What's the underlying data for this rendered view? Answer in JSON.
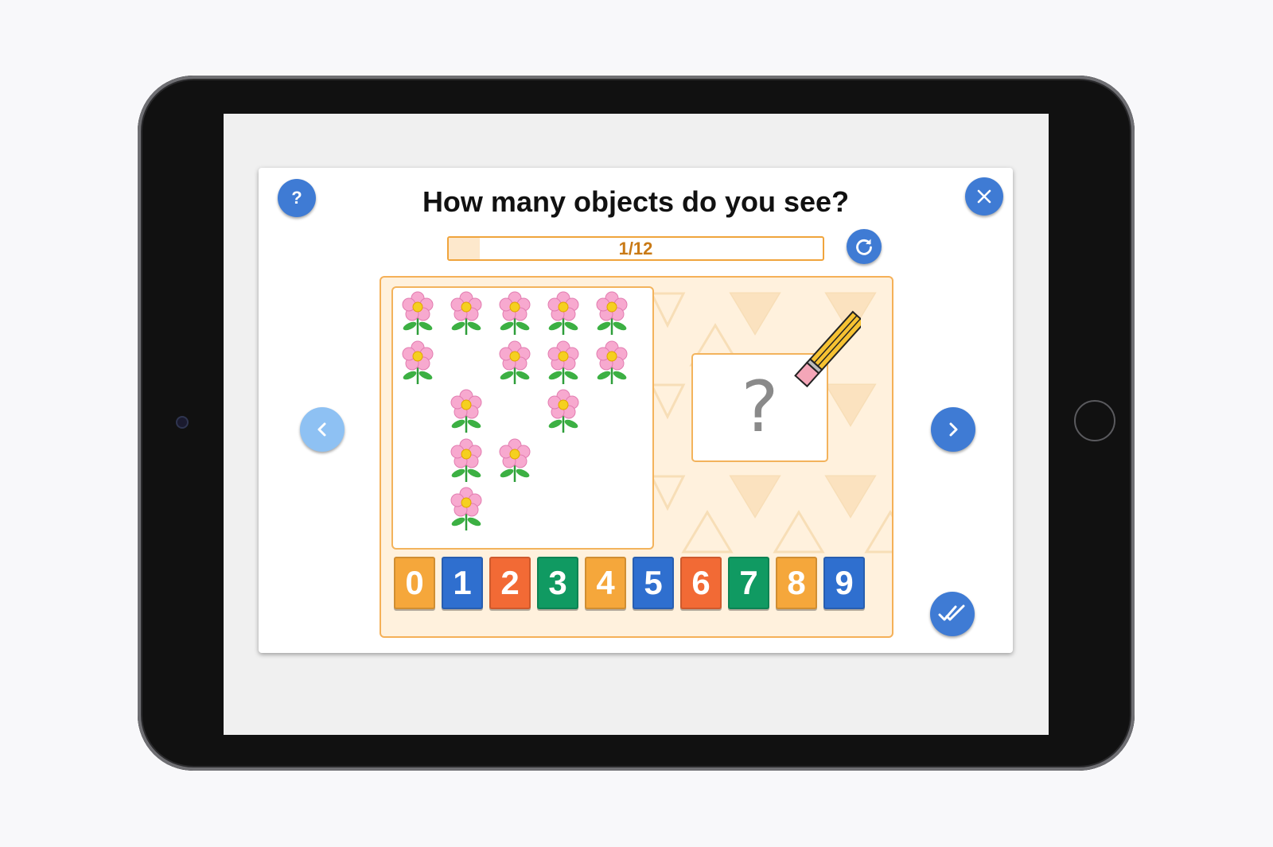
{
  "game": {
    "title": "How many objects do you see?",
    "progress_text": "1/12",
    "progress_fraction": 0.0833,
    "answer_placeholder": "?",
    "help_label": "?",
    "icons": {
      "help": "question-icon",
      "close": "close-icon",
      "refresh": "refresh-icon",
      "prev": "chevron-left-icon",
      "next": "chevron-right-icon",
      "check": "double-check-icon",
      "pencil": "pencil-icon",
      "flower": "flower-icon"
    },
    "flower_count": 14,
    "number_tiles": [
      {
        "label": "0",
        "color": "#f5a73b"
      },
      {
        "label": "1",
        "color": "#2f6fcf"
      },
      {
        "label": "2",
        "color": "#f26a35"
      },
      {
        "label": "3",
        "color": "#109a62"
      },
      {
        "label": "4",
        "color": "#f5a73b"
      },
      {
        "label": "5",
        "color": "#2f6fcf"
      },
      {
        "label": "6",
        "color": "#f26a35"
      },
      {
        "label": "7",
        "color": "#109a62"
      },
      {
        "label": "8",
        "color": "#f5a73b"
      },
      {
        "label": "9",
        "color": "#2f6fcf"
      }
    ]
  },
  "colors": {
    "accent_blue": "#3f7bd4",
    "disabled_blue": "#8ec1f3",
    "orange_border": "#f0a43c",
    "progress_text": "#c97a16"
  }
}
